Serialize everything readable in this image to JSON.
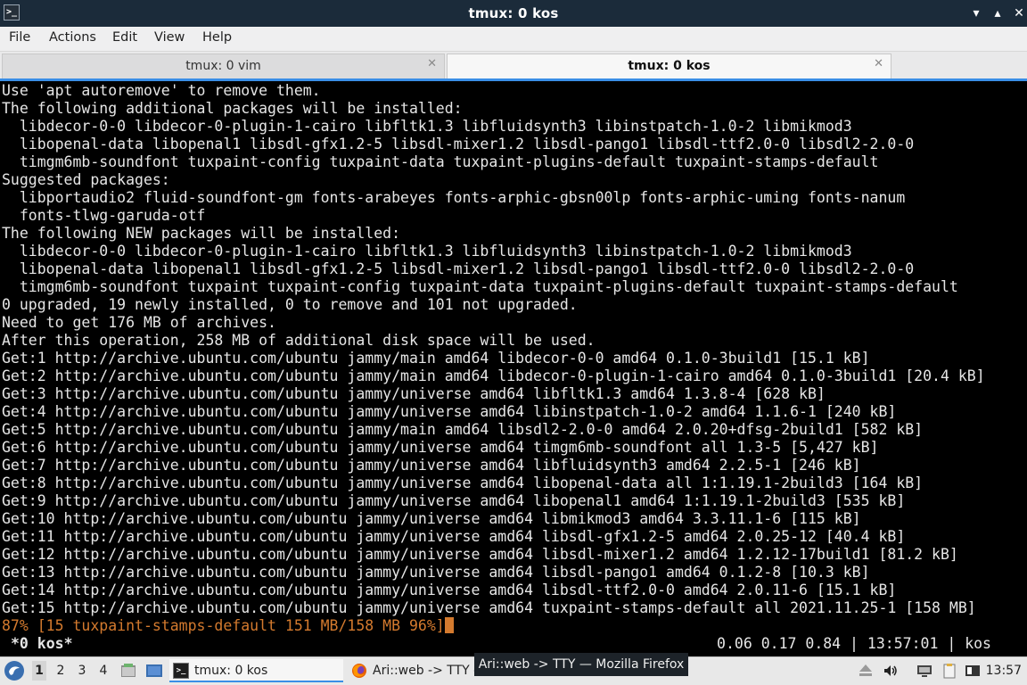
{
  "window": {
    "title": "tmux: 0 kos",
    "app_icon_glyph": ">_",
    "minimize_glyph": "▾",
    "maximize_glyph": "▴",
    "close_glyph": "✕"
  },
  "menu": [
    "File",
    "Actions",
    "Edit",
    "View",
    "Help"
  ],
  "tabs": [
    {
      "label": "tmux: 0 vim",
      "active": false
    },
    {
      "label": "tmux: 0 kos",
      "active": true
    }
  ],
  "tab_close_glyph": "✕",
  "terminal": {
    "lines": [
      "Use 'apt autoremove' to remove them.",
      "The following additional packages will be installed:",
      "  libdecor-0-0 libdecor-0-plugin-1-cairo libfltk1.3 libfluidsynth3 libinstpatch-1.0-2 libmikmod3",
      "  libopenal-data libopenal1 libsdl-gfx1.2-5 libsdl-mixer1.2 libsdl-pango1 libsdl-ttf2.0-0 libsdl2-2.0-0",
      "  timgm6mb-soundfont tuxpaint-config tuxpaint-data tuxpaint-plugins-default tuxpaint-stamps-default",
      "Suggested packages:",
      "  libportaudio2 fluid-soundfont-gm fonts-arabeyes fonts-arphic-gbsn00lp fonts-arphic-uming fonts-nanum",
      "  fonts-tlwg-garuda-otf",
      "The following NEW packages will be installed:",
      "  libdecor-0-0 libdecor-0-plugin-1-cairo libfltk1.3 libfluidsynth3 libinstpatch-1.0-2 libmikmod3",
      "  libopenal-data libopenal1 libsdl-gfx1.2-5 libsdl-mixer1.2 libsdl-pango1 libsdl-ttf2.0-0 libsdl2-2.0-0",
      "  timgm6mb-soundfont tuxpaint tuxpaint-config tuxpaint-data tuxpaint-plugins-default tuxpaint-stamps-default",
      "0 upgraded, 19 newly installed, 0 to remove and 101 not upgraded.",
      "Need to get 176 MB of archives.",
      "After this operation, 258 MB of additional disk space will be used.",
      "Get:1 http://archive.ubuntu.com/ubuntu jammy/main amd64 libdecor-0-0 amd64 0.1.0-3build1 [15.1 kB]",
      "Get:2 http://archive.ubuntu.com/ubuntu jammy/main amd64 libdecor-0-plugin-1-cairo amd64 0.1.0-3build1 [20.4 kB]",
      "Get:3 http://archive.ubuntu.com/ubuntu jammy/universe amd64 libfltk1.3 amd64 1.3.8-4 [628 kB]",
      "Get:4 http://archive.ubuntu.com/ubuntu jammy/universe amd64 libinstpatch-1.0-2 amd64 1.1.6-1 [240 kB]",
      "Get:5 http://archive.ubuntu.com/ubuntu jammy/main amd64 libsdl2-2.0-0 amd64 2.0.20+dfsg-2build1 [582 kB]",
      "Get:6 http://archive.ubuntu.com/ubuntu jammy/universe amd64 timgm6mb-soundfont all 1.3-5 [5,427 kB]",
      "Get:7 http://archive.ubuntu.com/ubuntu jammy/universe amd64 libfluidsynth3 amd64 2.2.5-1 [246 kB]",
      "Get:8 http://archive.ubuntu.com/ubuntu jammy/universe amd64 libopenal-data all 1:1.19.1-2build3 [164 kB]",
      "Get:9 http://archive.ubuntu.com/ubuntu jammy/universe amd64 libopenal1 amd64 1:1.19.1-2build3 [535 kB]",
      "Get:10 http://archive.ubuntu.com/ubuntu jammy/universe amd64 libmikmod3 amd64 3.3.11.1-6 [115 kB]",
      "Get:11 http://archive.ubuntu.com/ubuntu jammy/universe amd64 libsdl-gfx1.2-5 amd64 2.0.25-12 [40.4 kB]",
      "Get:12 http://archive.ubuntu.com/ubuntu jammy/universe amd64 libsdl-mixer1.2 amd64 1.2.12-17build1 [81.2 kB]",
      "Get:13 http://archive.ubuntu.com/ubuntu jammy/universe amd64 libsdl-pango1 amd64 0.1.2-8 [10.3 kB]",
      "Get:14 http://archive.ubuntu.com/ubuntu jammy/universe amd64 libsdl-ttf2.0-0 amd64 2.0.11-6 [15.1 kB]",
      "Get:15 http://archive.ubuntu.com/ubuntu jammy/universe amd64 tuxpaint-stamps-default all 2021.11.25-1 [158 MB]"
    ],
    "progress_line": "87% [15 tuxpaint-stamps-default 151 MB/158 MB 96%]",
    "progress_color": "#d47a2e"
  },
  "tmux_status": {
    "left": "*0 kos*",
    "right": "0.06 0.17 0.84 | 13:57:01 | kos"
  },
  "taskbar": {
    "desktops": [
      "1",
      "2",
      "3",
      "4"
    ],
    "tasks": [
      {
        "label": "tmux: 0 kos",
        "active": true
      },
      {
        "label": "Ari::web -> TTY — ",
        "active": false
      }
    ],
    "tooltip": "Ari::web -> TTY — Mozilla Firefox",
    "clock": "13:57"
  },
  "colors": {
    "titlebar_bg": "#1b2b3a",
    "accent": "#3a8ee6"
  }
}
